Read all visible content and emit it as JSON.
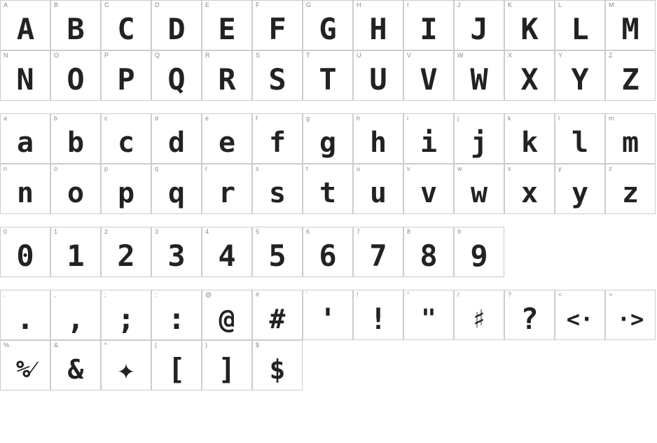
{
  "sections": [
    {
      "id": "uppercase",
      "rows": [
        {
          "cells": [
            {
              "label": "A",
              "glyph": "A"
            },
            {
              "label": "B",
              "glyph": "B"
            },
            {
              "label": "C",
              "glyph": "C"
            },
            {
              "label": "D",
              "glyph": "D"
            },
            {
              "label": "E",
              "glyph": "E"
            },
            {
              "label": "F",
              "glyph": "F"
            },
            {
              "label": "G",
              "glyph": "G"
            },
            {
              "label": "H",
              "glyph": "H"
            },
            {
              "label": "I",
              "glyph": "I"
            },
            {
              "label": "J",
              "glyph": "J"
            },
            {
              "label": "K",
              "glyph": "K"
            },
            {
              "label": "L",
              "glyph": "L"
            },
            {
              "label": "M",
              "glyph": "M"
            }
          ]
        },
        {
          "cells": [
            {
              "label": "N",
              "glyph": "N"
            },
            {
              "label": "O",
              "glyph": "O"
            },
            {
              "label": "P",
              "glyph": "P"
            },
            {
              "label": "Q",
              "glyph": "Q"
            },
            {
              "label": "R",
              "glyph": "R"
            },
            {
              "label": "S",
              "glyph": "S"
            },
            {
              "label": "T",
              "glyph": "T"
            },
            {
              "label": "U",
              "glyph": "U"
            },
            {
              "label": "V",
              "glyph": "V"
            },
            {
              "label": "W",
              "glyph": "W"
            },
            {
              "label": "X",
              "glyph": "X"
            },
            {
              "label": "Y",
              "glyph": "Y"
            },
            {
              "label": "Z",
              "glyph": "Z"
            }
          ]
        }
      ]
    },
    {
      "id": "lowercase",
      "rows": [
        {
          "cells": [
            {
              "label": "a",
              "glyph": "a"
            },
            {
              "label": "b",
              "glyph": "b"
            },
            {
              "label": "c",
              "glyph": "c"
            },
            {
              "label": "d",
              "glyph": "d"
            },
            {
              "label": "e",
              "glyph": "e"
            },
            {
              "label": "f",
              "glyph": "f"
            },
            {
              "label": "g",
              "glyph": "g"
            },
            {
              "label": "h",
              "glyph": "h"
            },
            {
              "label": "i",
              "glyph": "i"
            },
            {
              "label": "j",
              "glyph": "j"
            },
            {
              "label": "k",
              "glyph": "k"
            },
            {
              "label": "l",
              "glyph": "l"
            },
            {
              "label": "m",
              "glyph": "m"
            }
          ]
        },
        {
          "cells": [
            {
              "label": "n",
              "glyph": "n"
            },
            {
              "label": "o",
              "glyph": "o"
            },
            {
              "label": "p",
              "glyph": "p"
            },
            {
              "label": "q",
              "glyph": "q"
            },
            {
              "label": "r",
              "glyph": "r"
            },
            {
              "label": "s",
              "glyph": "s"
            },
            {
              "label": "t",
              "glyph": "t"
            },
            {
              "label": "u",
              "glyph": "u"
            },
            {
              "label": "v",
              "glyph": "v"
            },
            {
              "label": "w",
              "glyph": "w"
            },
            {
              "label": "x",
              "glyph": "x"
            },
            {
              "label": "y",
              "glyph": "y"
            },
            {
              "label": "z",
              "glyph": "z"
            }
          ]
        }
      ]
    },
    {
      "id": "numbers",
      "rows": [
        {
          "cells": [
            {
              "label": "0",
              "glyph": "0"
            },
            {
              "label": "1",
              "glyph": "1"
            },
            {
              "label": "2",
              "glyph": "2"
            },
            {
              "label": "3",
              "glyph": "3"
            },
            {
              "label": "4",
              "glyph": "4"
            },
            {
              "label": "5",
              "glyph": "5"
            },
            {
              "label": "6",
              "glyph": "6"
            },
            {
              "label": "7",
              "glyph": "7"
            },
            {
              "label": "8",
              "glyph": "8"
            },
            {
              "label": "9",
              "glyph": "9"
            }
          ]
        }
      ]
    },
    {
      "id": "punctuation",
      "rows": [
        {
          "cells": [
            {
              "label": ".",
              "glyph": "."
            },
            {
              "label": ",",
              "glyph": ","
            },
            {
              "label": ";",
              "glyph": ";"
            },
            {
              "label": ":",
              "glyph": ":"
            },
            {
              "label": "@",
              "glyph": "@"
            },
            {
              "label": "#",
              "glyph": "#"
            },
            {
              "label": "'",
              "glyph": "‘"
            },
            {
              "label": "!",
              "glyph": "!"
            },
            {
              "label": "\"",
              "glyph": "“"
            },
            {
              "label": "/",
              "glyph": "♯"
            },
            {
              "label": "?",
              "glyph": "?"
            },
            {
              "label": "<",
              "glyph": "‹·"
            },
            {
              "label": ">",
              "glyph": "·›"
            }
          ]
        },
        {
          "cells": [
            {
              "label": "%",
              "glyph": "%⁄"
            },
            {
              "label": "&",
              "glyph": "&"
            },
            {
              "label": "*",
              "glyph": "∗"
            },
            {
              "label": "(",
              "glyph": "["
            },
            {
              "label": ")",
              "glyph": "]"
            },
            {
              "label": "$",
              "glyph": "$"
            }
          ]
        }
      ]
    }
  ]
}
